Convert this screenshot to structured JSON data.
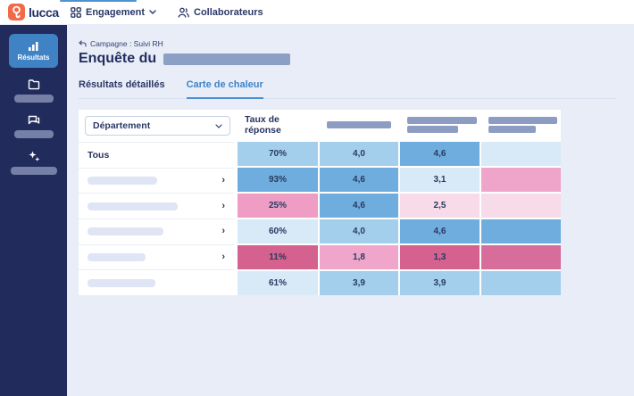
{
  "browser": {
    "tab_indicator_color": "#4f92d2"
  },
  "topbar": {
    "logo_text": "lucca",
    "nav": [
      {
        "label": "Engagement",
        "icon": "grid-icon",
        "has_chevron": true
      },
      {
        "label": "Collaborateurs",
        "icon": "people-icon",
        "has_chevron": false
      }
    ]
  },
  "sidebar": {
    "items": [
      {
        "label": "Résultats",
        "icon": "bar-chart-icon",
        "active": true
      },
      {
        "label": "",
        "icon": "folder-icon",
        "redacted": true
      },
      {
        "label": "",
        "icon": "chat-icon",
        "redacted": true
      },
      {
        "label": "",
        "icon": "sparkle-icon",
        "redacted": true
      }
    ]
  },
  "page": {
    "breadcrumb": "Campagne : Suivi RH",
    "title_prefix": "Enquête du"
  },
  "tabs": [
    {
      "label": "Résultats détaillés",
      "active": false
    },
    {
      "label": "Carte de chaleur",
      "active": true
    }
  ],
  "heatmap": {
    "filter": {
      "selected": "Département"
    },
    "columns": [
      {
        "label": "Taux de réponse",
        "redacted": false
      },
      {
        "label": "",
        "redacted": true
      },
      {
        "label": "",
        "redacted": true
      },
      {
        "label": "",
        "redacted": true
      }
    ],
    "palette": {
      "blue_strong": "#6fadde",
      "blue_mid": "#a3cfec",
      "blue_light": "#d8eaf8",
      "pink_strong": "#d5618f",
      "pink_mid": "#efa3c8",
      "pink_light": "#f8dbe9"
    },
    "rows": [
      {
        "label": "Tous",
        "redacted": false,
        "expandable": false,
        "cells": [
          {
            "value": "70%",
            "bg": "#a3cfec"
          },
          {
            "value": "4,0",
            "bg": "#a3cfec"
          },
          {
            "value": "4,6",
            "bg": "#6fadde"
          },
          {
            "value": "",
            "bg": "#d8eaf8"
          }
        ]
      },
      {
        "label": "",
        "redacted": true,
        "expandable": true,
        "cells": [
          {
            "value": "93%",
            "bg": "#6fadde"
          },
          {
            "value": "4,6",
            "bg": "#6fadde"
          },
          {
            "value": "3,1",
            "bg": "#d8eaf8"
          },
          {
            "value": "",
            "bg": "#eea5c9"
          }
        ]
      },
      {
        "label": "",
        "redacted": true,
        "expandable": true,
        "cells": [
          {
            "value": "25%",
            "bg": "#ef9dc4"
          },
          {
            "value": "4,6",
            "bg": "#6fadde"
          },
          {
            "value": "2,5",
            "bg": "#f8dbe9"
          },
          {
            "value": "",
            "bg": "#f8dbe9"
          }
        ]
      },
      {
        "label": "",
        "redacted": true,
        "expandable": true,
        "cells": [
          {
            "value": "60%",
            "bg": "#d8eaf8"
          },
          {
            "value": "4,0",
            "bg": "#a3cfec"
          },
          {
            "value": "4,6",
            "bg": "#6fadde"
          },
          {
            "value": "",
            "bg": "#6fadde"
          }
        ]
      },
      {
        "label": "",
        "redacted": true,
        "expandable": true,
        "cells": [
          {
            "value": "11%",
            "bg": "#d5618f"
          },
          {
            "value": "1,8",
            "bg": "#f0a6ca"
          },
          {
            "value": "1,3",
            "bg": "#d5618f"
          },
          {
            "value": "",
            "bg": "#d66d9b"
          }
        ]
      },
      {
        "label": "",
        "redacted": true,
        "expandable": false,
        "cells": [
          {
            "value": "61%",
            "bg": "#d8eaf8"
          },
          {
            "value": "3,9",
            "bg": "#a3cfec"
          },
          {
            "value": "3,9",
            "bg": "#a3cfec"
          },
          {
            "value": "",
            "bg": "#a3cfec"
          }
        ]
      }
    ]
  }
}
